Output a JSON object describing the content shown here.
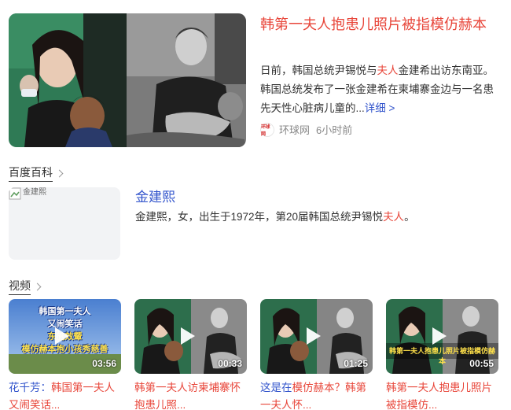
{
  "news": {
    "title": "韩第一夫人抱患儿照片被指模仿赫本",
    "summary_pre": "日前，韩国总统尹锡悦与",
    "summary_hl": "夫人",
    "summary_post": "金建希出访东南亚。韩国总统发布了一张金建希在柬埔寨金边与一名患先天性心脏病儿童的...",
    "detail_link": "详细 >",
    "source_logo_text": "环球网",
    "source_name": "环球网",
    "time": "6小时前"
  },
  "baike": {
    "section_title": "百度百科",
    "image_alt": "金建熙",
    "name": "金建熙",
    "desc_pre": "金建熙，女，出生于1972年，第20届韩国总统尹锡悦",
    "desc_hl": "夫人",
    "desc_post": "。"
  },
  "videos": {
    "section_title": "视频",
    "items": [
      {
        "duration": "03:56",
        "overlay_lines": [
          "韩国第一夫人",
          "又闹笑话",
          "东施效颦",
          "模仿赫本抱小孩秀慈善"
        ],
        "title_a": "花千芳：",
        "title_b": "韩国第一夫人又闹笑话..."
      },
      {
        "duration": "00:33",
        "title_a": "",
        "title_b": "韩第一夫人访柬埔寨怀抱患儿照..."
      },
      {
        "duration": "01:25",
        "title_a": "这是在",
        "title_b": "模仿赫本？韩第一夫人怀..."
      },
      {
        "duration": "00:55",
        "overlay_lines": [
          "韩第一夫人抱患儿照片被指模仿赫本"
        ],
        "title_a": "",
        "title_b": "韩第一夫人抱患儿照片被指模仿..."
      }
    ]
  },
  "colors": {
    "accent_red": "#e8463a",
    "link_blue": "#3355cc",
    "meta_gray": "#888888"
  }
}
